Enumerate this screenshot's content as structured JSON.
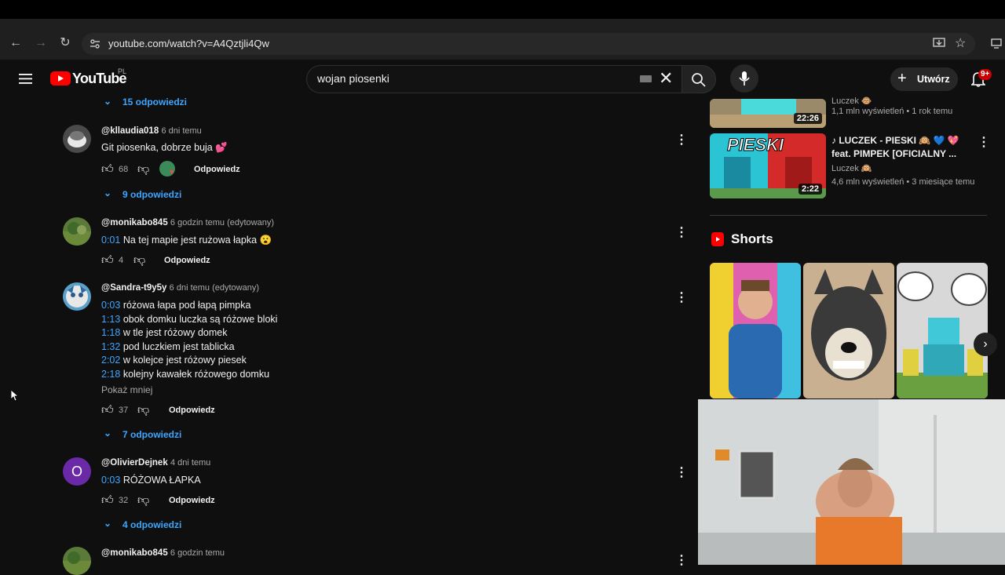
{
  "browser": {
    "url": "youtube.com/watch?v=A4Qztjli4Qw",
    "back_icon": "←",
    "forward_icon": "→",
    "reload_icon": "↻"
  },
  "header": {
    "logo_text": "YouTube",
    "region": "PL",
    "search_value": "wojan piosenki",
    "create_label": "Utwórz",
    "notifications_badge": "9+"
  },
  "comments": [
    {
      "type": "replies",
      "label": "15 odpowiedzi"
    },
    {
      "handle": "@kllaudia018",
      "time": "6 dni temu",
      "lines": [
        {
          "ts": "",
          "text": "Git piosenka, dobrze buja 💕"
        }
      ],
      "likes": "68",
      "reply_label": "Odpowiedz",
      "replies": "9 odpowiedzi"
    },
    {
      "handle": "@monikabo845",
      "time": "6 godzin temu (edytowany)",
      "lines": [
        {
          "ts": "0:01",
          "text": " Na tej mapie jest rużowa łapka 😮"
        }
      ],
      "likes": "4",
      "reply_label": "Odpowiedz"
    },
    {
      "handle": "@Sandra-t9y5y",
      "time": "6 dni temu (edytowany)",
      "lines": [
        {
          "ts": "0:03",
          "text": " różowa łapa pod łapą pimpka"
        },
        {
          "ts": "1:13",
          "text": " obok domku luczka są różowe bloki"
        },
        {
          "ts": "1:18",
          "text": " w tle jest różowy domek"
        },
        {
          "ts": "1:32",
          "text": " pod luczkiem jest tablicka"
        },
        {
          "ts": "2:02",
          "text": " w kolejce jest różowy piesek"
        },
        {
          "ts": "2:18",
          "text": " kolejny kawałek różowego domku"
        }
      ],
      "show_less": "Pokaż mniej",
      "likes": "37",
      "reply_label": "Odpowiedz",
      "replies": "7 odpowiedzi"
    },
    {
      "handle": "@OlivierDejnek",
      "time": "4 dni temu",
      "avatar_letter": "O",
      "lines": [
        {
          "ts": "0:03",
          "text": " RÓŻOWA ŁAPKA"
        }
      ],
      "likes": "32",
      "reply_label": "Odpowiedz",
      "replies": "4 odpowiedzi"
    },
    {
      "handle": "@monikabo845",
      "time": "6 godzin temu"
    }
  ],
  "sidebar": {
    "video1": {
      "duration": "22:26",
      "channel": "Luczek 🐵",
      "meta": "1,1 mln wyświetleń • 1 rok temu"
    },
    "video2": {
      "duration": "2:22",
      "title_line1": "♪ LUCZEK - PIESKI 🙉 💙 💖",
      "title_line2": "feat. PIMPEK [OFICIALNY ...",
      "channel": "Luczek 🙉",
      "meta": "4,6 mln wyświetleń • 3 miesiące temu",
      "thumb_text": "PIESKI"
    },
    "shorts_title": "Shorts"
  },
  "colors": {
    "accent": "#3ea6ff",
    "youtube_red": "#ff0000",
    "bg": "#0f0f0f"
  }
}
